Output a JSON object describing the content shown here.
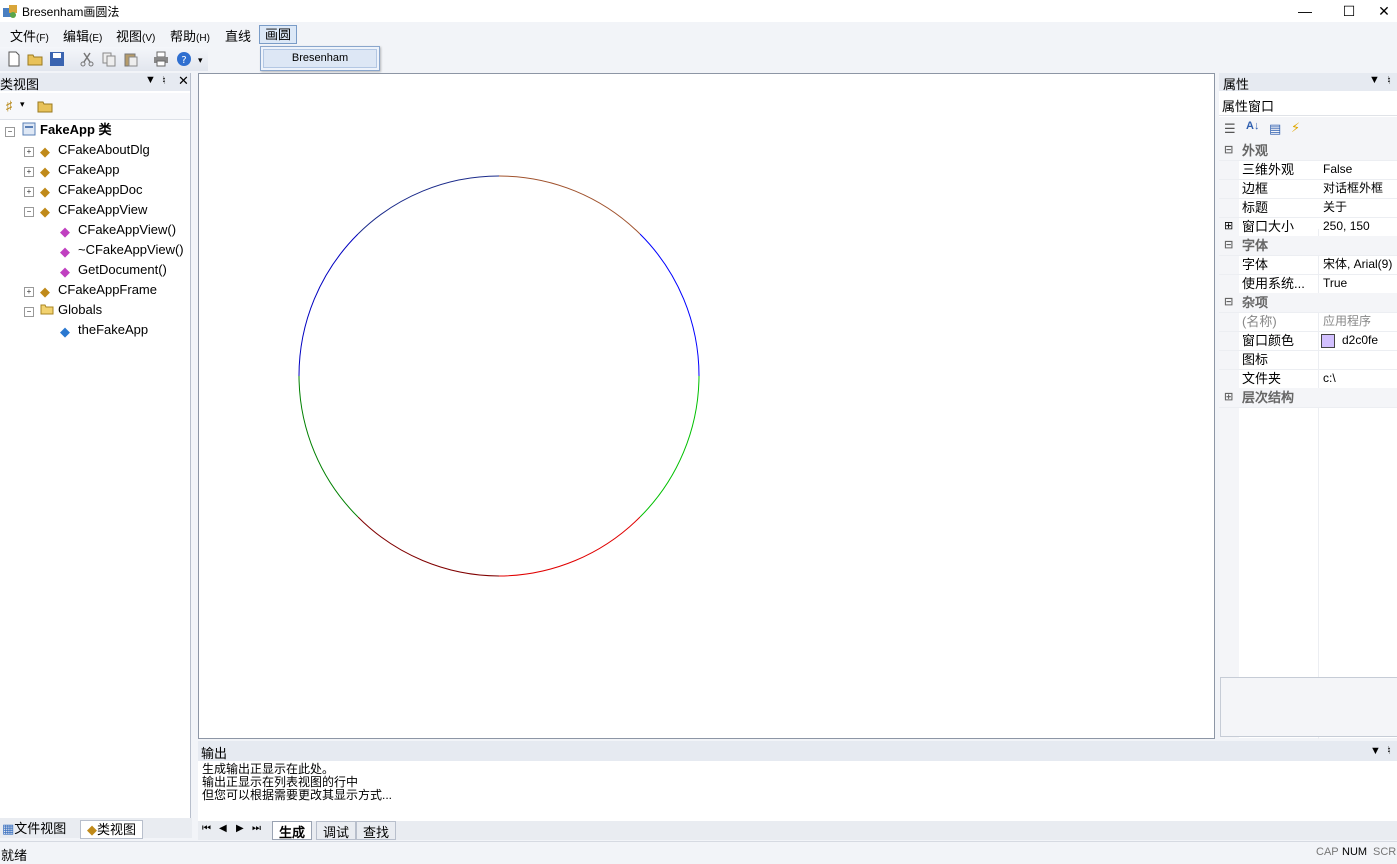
{
  "window": {
    "title": "Bresenham画圆法"
  },
  "menubar": {
    "items": [
      {
        "label": "文件",
        "accel": "(F)"
      },
      {
        "label": "编辑",
        "accel": "(E)"
      },
      {
        "label": "视图",
        "accel": "(V)"
      },
      {
        "label": "帮助",
        "accel": "(H)"
      },
      {
        "label": "直线",
        "accel": ""
      },
      {
        "label": "画圆",
        "accel": ""
      }
    ],
    "open_menu_items": [
      "Bresenham"
    ]
  },
  "class_view": {
    "title": "类视图",
    "root": "FakeApp 类",
    "nodes": [
      "CFakeAboutDlg",
      "CFakeApp",
      "CFakeAppDoc",
      "CFakeAppView",
      "CFakeAppView()",
      "~CFakeAppView()",
      "GetDocument()",
      "CFakeAppFrame",
      "Globals",
      "theFakeApp"
    ],
    "tabs": [
      "文件视图",
      "类视图"
    ]
  },
  "properties": {
    "title": "属性",
    "combo": "属性窗口",
    "categories": [
      "外观",
      "字体",
      "杂项",
      "层次结构"
    ],
    "rows": [
      {
        "name": "三维外观",
        "value": "False"
      },
      {
        "name": "边框",
        "value": "对话框外框"
      },
      {
        "name": "标题",
        "value": "关于"
      },
      {
        "name": "窗口大小",
        "value": "250, 150"
      },
      {
        "name": "字体",
        "value": "宋体, Arial(9)"
      },
      {
        "name": "使用系统...",
        "value": "True"
      },
      {
        "name": "(名称)",
        "value": "应用程序"
      },
      {
        "name": "窗口颜色",
        "value": "d2c0fe"
      },
      {
        "name": "图标",
        "value": ""
      },
      {
        "name": "文件夹",
        "value": "c:\\"
      }
    ],
    "swatch_color": "#d2c0fe"
  },
  "output": {
    "title": "输出",
    "lines": [
      "生成输出正显示在此处。",
      "输出正显示在列表视图的行中",
      "但您可以根据需要更改其显示方式..."
    ],
    "tabs": [
      "生成",
      "调试",
      "查找"
    ]
  },
  "status": {
    "text": "就绪",
    "indicators": [
      "CAP",
      "NUM",
      "SCRL"
    ]
  },
  "circle": {
    "octant_colors": {
      "top_right": "#0000ff",
      "top_left_upper": "#804000",
      "left": "#0000ff",
      "bottom_left": "#008000",
      "bottom": "#800000",
      "right_lower": "#00cc00",
      "right": "#0000ff",
      "bottom_right": "#ff0000"
    }
  }
}
